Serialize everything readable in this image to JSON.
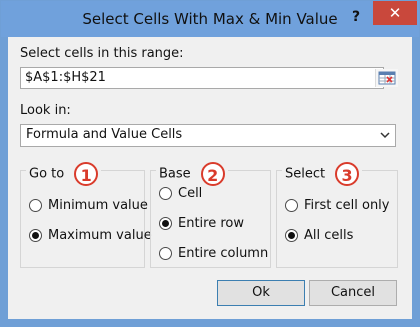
{
  "window": {
    "title": "Select Cells With Max & Min Value",
    "help_label": "?",
    "close_label": "✕"
  },
  "range": {
    "label": "Select cells in this range:",
    "value": "$A$1:$H$21"
  },
  "look_in": {
    "label": "Look in:",
    "selected": "Formula and Value Cells"
  },
  "goto": {
    "title": "Go to",
    "badge": "1",
    "options": [
      {
        "label": "Minimum value",
        "checked": false
      },
      {
        "label": "Maximum value",
        "checked": true
      }
    ]
  },
  "base": {
    "title": "Base",
    "badge": "2",
    "options": [
      {
        "label": "Cell",
        "checked": false
      },
      {
        "label": "Entire row",
        "checked": true
      },
      {
        "label": "Entire column",
        "checked": false
      }
    ]
  },
  "select": {
    "title": "Select",
    "badge": "3",
    "options": [
      {
        "label": "First cell only",
        "checked": false
      },
      {
        "label": "All cells",
        "checked": true
      }
    ]
  },
  "buttons": {
    "ok": "Ok",
    "cancel": "Cancel"
  },
  "colors": {
    "titlebar": "#70a1dc",
    "close": "#c9483c",
    "badge": "#d93b2b"
  }
}
